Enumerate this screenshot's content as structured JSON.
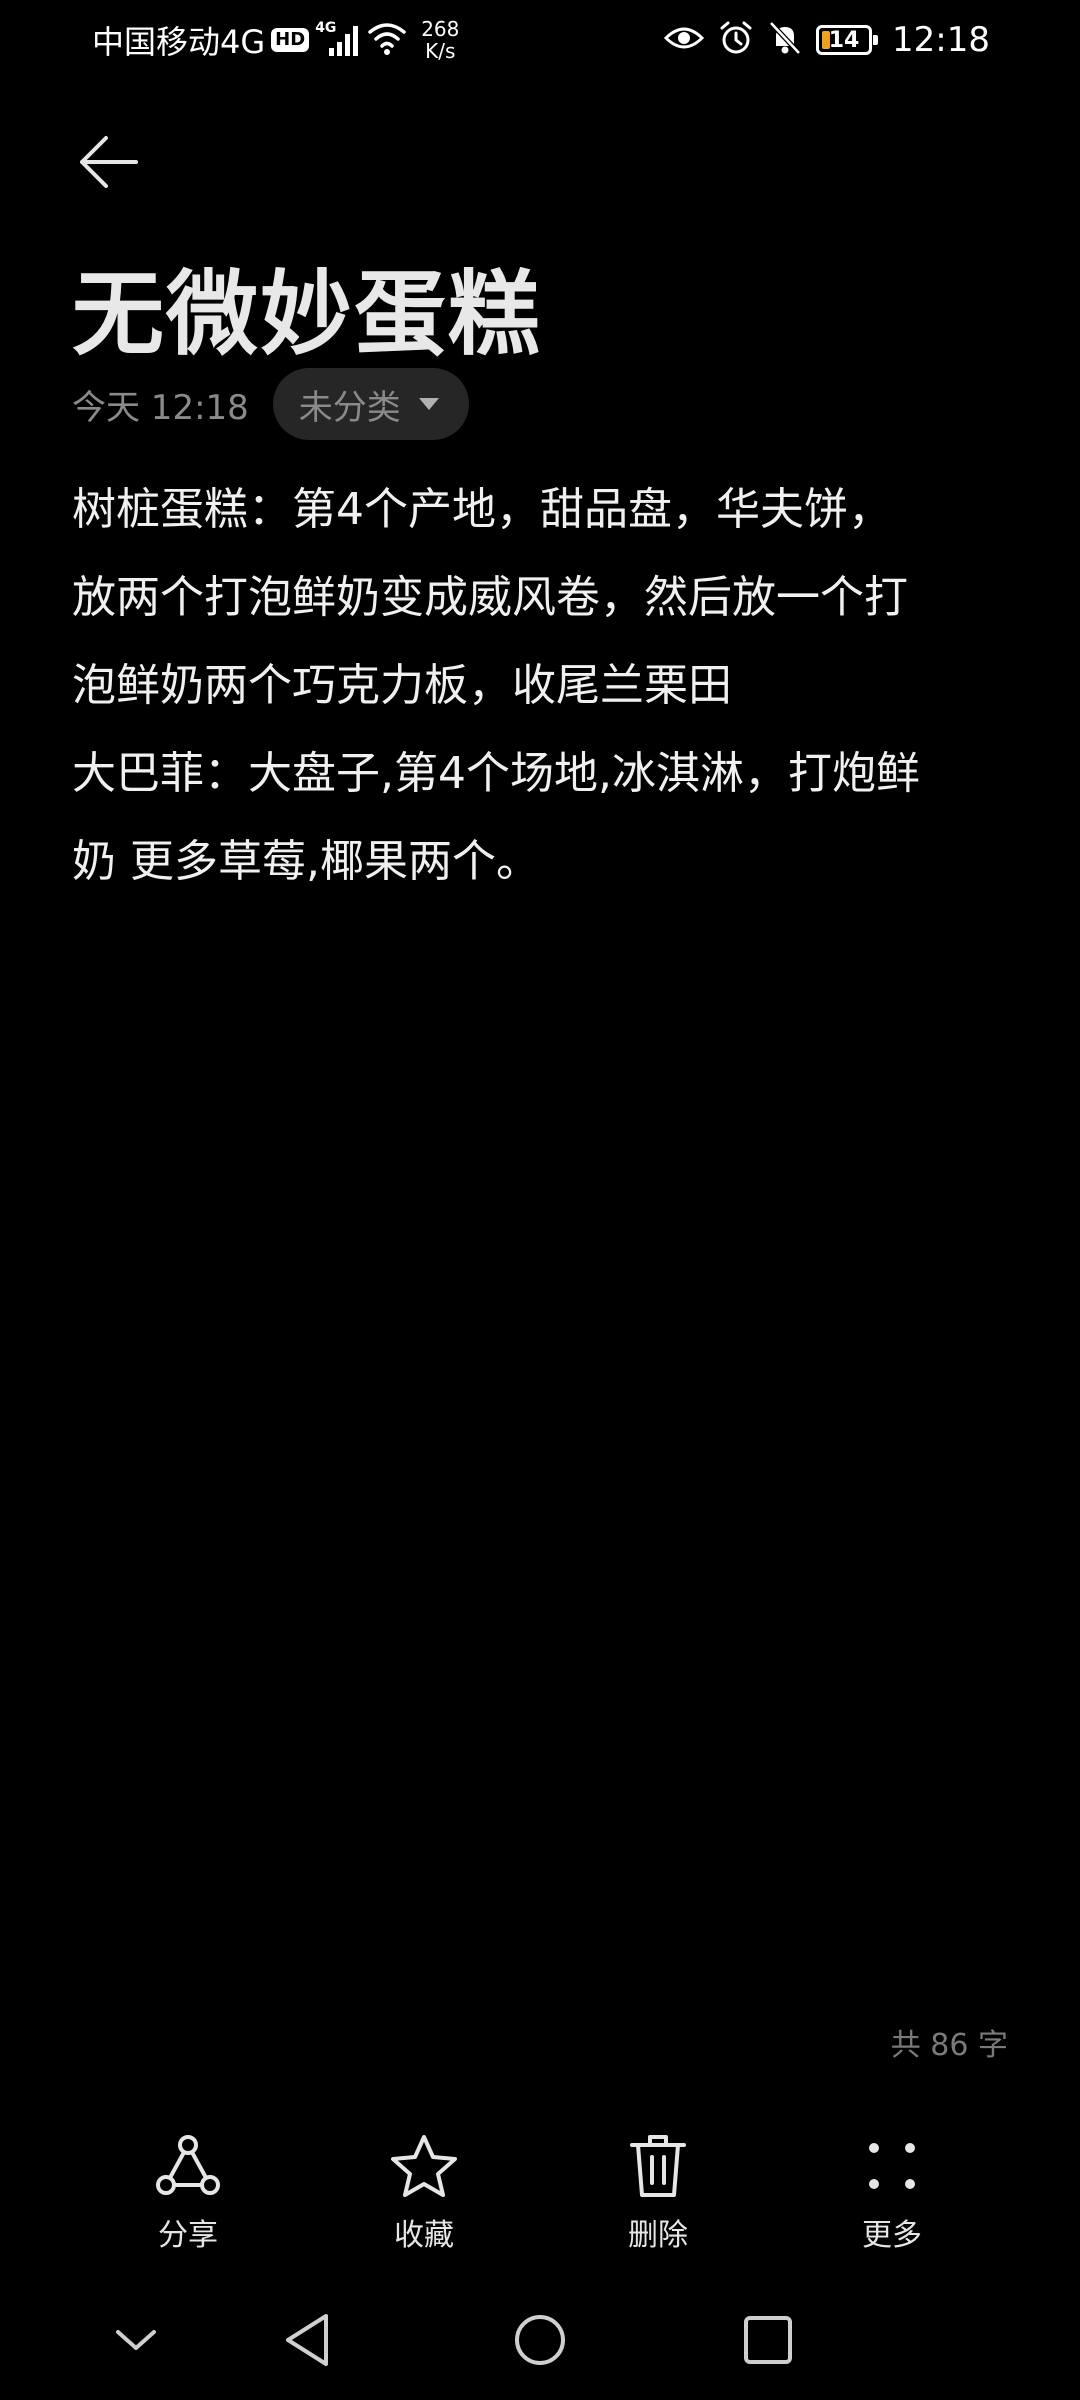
{
  "status_bar": {
    "carrier": "中国移动4G",
    "hd_badge": "HD",
    "signal_tag": "4G",
    "net_speed_value": "268",
    "net_speed_unit": "K/s",
    "battery_level": "14",
    "time": "12:18"
  },
  "note": {
    "title": "无微妙蛋糕",
    "timestamp": "今天 12:18",
    "category": "未分类",
    "lines": [
      "树桩蛋糕：第4个产地，甜品盘，华夫饼，",
      "放两个打泡鲜奶变成威风卷，然后放一个打",
      "泡鲜奶两个巧克力板，收尾兰栗田",
      "大巴菲：大盘子,第4个场地,冰淇淋，打炮鲜",
      "奶 更多草莓,椰果两个。"
    ],
    "word_count": "共 86 字"
  },
  "toolbar": {
    "share_label": "分享",
    "favorite_label": "收藏",
    "delete_label": "删除",
    "more_label": "更多"
  },
  "icons": {
    "back": "arrow-left-icon",
    "share": "share-icon",
    "favorite": "star-icon",
    "delete": "trash-icon",
    "more": "dots-grid-icon"
  },
  "colors": {
    "background": "#000000",
    "text": "#f0f0f0",
    "muted": "#8a8a8a",
    "chip_bg": "#262626",
    "battery_fill": "#f0a020"
  }
}
